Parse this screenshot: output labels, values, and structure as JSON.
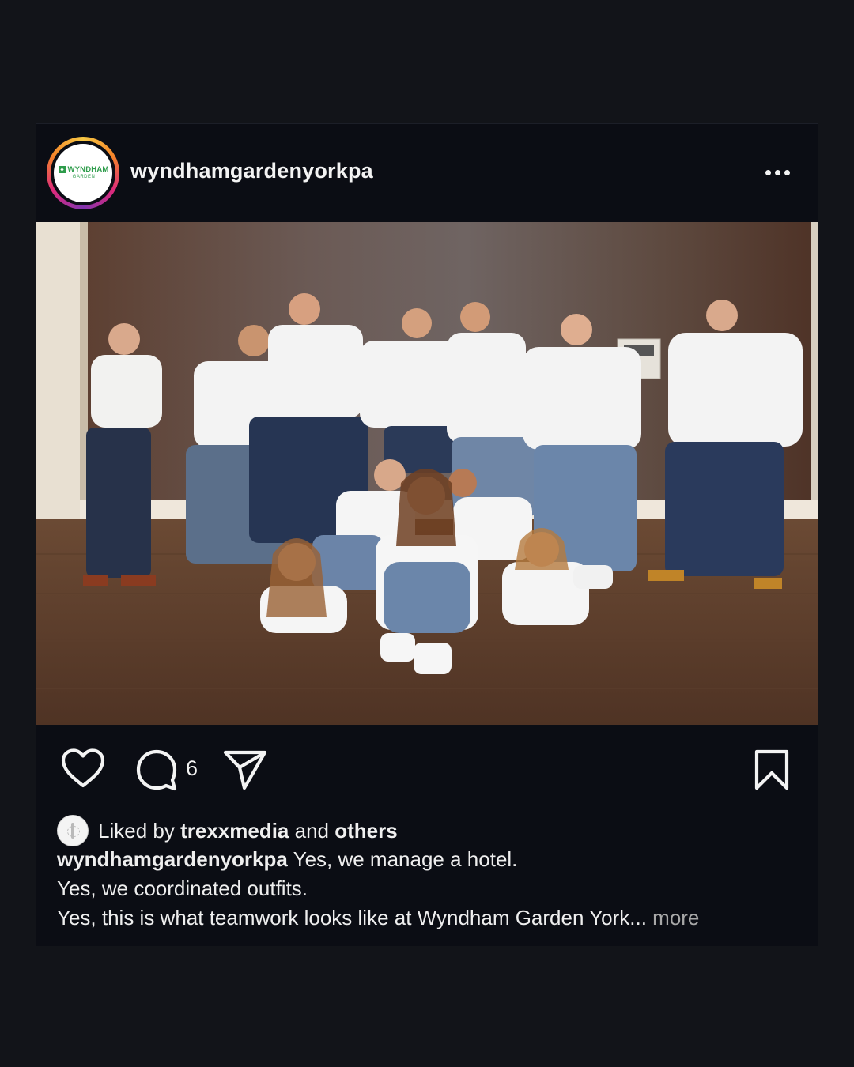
{
  "post": {
    "username": "wyndhamgardenyorkpa",
    "avatar_brand": "WYNDHAM",
    "avatar_brand_sub": "GARDEN",
    "more_icon": "more-horizontal-icon",
    "image_description_icon": "photo"
  },
  "actions": {
    "like_icon": "heart-outline-icon",
    "comment_icon": "comment-bubble-icon",
    "comment_count": "6",
    "share_icon": "send-paper-plane-icon",
    "save_icon": "bookmark-outline-icon"
  },
  "likes": {
    "prefix": "Liked by ",
    "user": "trexxmedia",
    "joiner": " and ",
    "others": "others"
  },
  "caption": {
    "user": "wyndhamgardenyorkpa",
    "line1": " Yes, we manage a hotel.",
    "line2": "Yes, we coordinated outfits.",
    "line3": "Yes, this is what teamwork looks like at Wyndham Garden York... ",
    "more": "more"
  },
  "colors": {
    "background": "#121419",
    "card": "#0b0d14",
    "text": "#f3f3f3",
    "muted": "#a8a8a8",
    "brand_green": "#2e9c4b"
  }
}
